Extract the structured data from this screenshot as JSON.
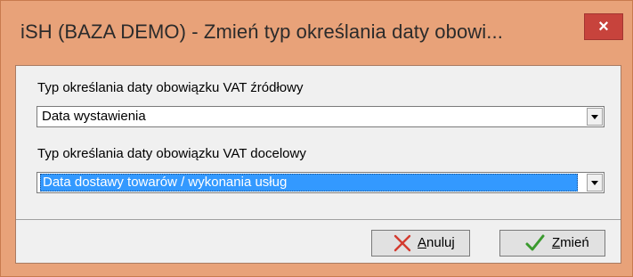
{
  "window": {
    "title": "iSH (BAZA DEMO) - Zmień typ określania daty obowi..."
  },
  "close_glyph": "×",
  "source": {
    "label": "Typ określania daty obowiązku VAT źródłowy",
    "value": "Data wystawienia"
  },
  "target": {
    "label": "Typ określania daty obowiązku VAT docelowy",
    "value": "Data dostawy towarów / wykonania usług"
  },
  "buttons": {
    "cancel": {
      "underlined": "A",
      "rest": "nuluj"
    },
    "confirm": {
      "underlined": "Z",
      "rest": "mień"
    }
  },
  "colors": {
    "frame": "#e8a279",
    "close": "#c7433c",
    "selection": "#3399ff",
    "cancel_icon": "#d43a2f",
    "confirm_icon": "#3a9a2e"
  },
  "icons": {
    "cancel": "x-icon",
    "confirm": "check-icon",
    "close": "close-icon",
    "dropdown": "chevron-down-icon"
  }
}
